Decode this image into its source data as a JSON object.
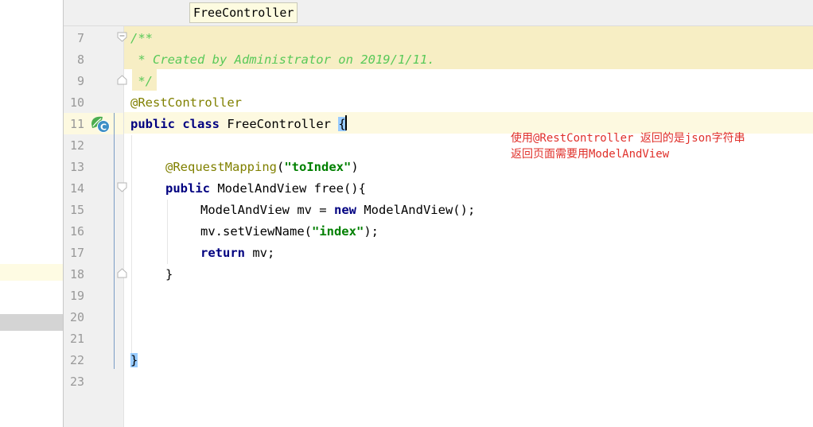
{
  "breadcrumb": "FreeController",
  "line_numbers": [
    "7",
    "8",
    "9",
    "10",
    "11",
    "12",
    "13",
    "14",
    "15",
    "16",
    "17",
    "18",
    "19",
    "20",
    "21",
    "22",
    "23"
  ],
  "code": {
    "l7": "/**",
    "l8": " * Created by Administrator on 2019/1/11.",
    "l9": " */",
    "l10": "@RestController",
    "l11_kw1": "public",
    "l11_kw2": "class",
    "l11_name": " FreeController ",
    "l11_brace": "{",
    "l13_ann": "@RequestMapping",
    "l13_open": "(",
    "l13_str": "\"toIndex\"",
    "l13_close": ")",
    "l14_kw": "public",
    "l14_rest": " ModelAndView free(){",
    "l15_a": "ModelAndView mv = ",
    "l15_kw": "new",
    "l15_b": " ModelAndView();",
    "l16_a": "mv.setViewName(",
    "l16_str": "\"index\"",
    "l16_b": ");",
    "l17_kw": "return",
    "l17_b": " mv;",
    "l18": "}",
    "l22": "}"
  },
  "annotation_note": {
    "line1": "使用@RestController 返回的是json字符串",
    "line2": "返回页面需要用ModelAndView"
  },
  "colors": {
    "keyword": "#000080",
    "annotation": "#808000",
    "string": "#008000",
    "comment": "#59c959",
    "note": "#e0302a"
  },
  "gutter_icon": "spring-bean-class-icon"
}
